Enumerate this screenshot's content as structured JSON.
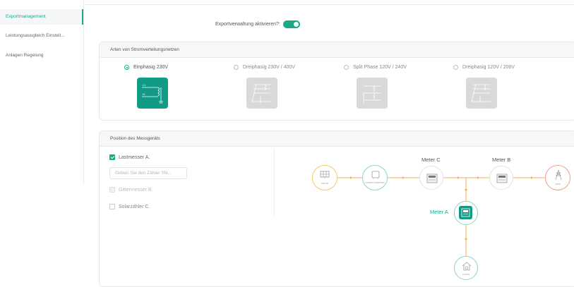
{
  "sidebar": {
    "items": [
      {
        "label": "Exportmanagement",
        "active": true
      },
      {
        "label": "Leistungsausgleich Einstell..."
      },
      {
        "label": "Anlagen Regelung"
      }
    ]
  },
  "export": {
    "label": "Exportverwaltung aktivieren?:",
    "enabled": true
  },
  "grid_types": {
    "title": "Arten von Stromverteilungsnetzen",
    "options": [
      {
        "label": "Einphasig 230V",
        "selected": true
      },
      {
        "label": "Dreiphasig 230V / 400V",
        "selected": false
      },
      {
        "label": "Split Phase 120V / 240V",
        "selected": false
      },
      {
        "label": "Dreiphasig 120V / 208V",
        "selected": false
      }
    ]
  },
  "meter_position": {
    "title": "Position des Messgeräts",
    "load_meter": {
      "label": "Lastmesser A.",
      "checked": true
    },
    "sn_input": {
      "placeholder": "Geben Sie den Zähler SN...",
      "value": ""
    },
    "grid_meter": {
      "label": "Gittermesser B.",
      "checked": false,
      "disabled": true
    },
    "solar_meter": {
      "label": "Solarzähler C.",
      "checked": false
    },
    "diagram": {
      "meter_c": "Meter C",
      "meter_b": "Meter B",
      "meter_a": "Meter A",
      "solar": "SOLAR",
      "inverter": "HYBRID INVERTER",
      "grid": "GRID",
      "loads": "LOADS"
    }
  },
  "colors": {
    "accent": "#1aaa8a",
    "solar_ring": "#f5c86a",
    "inverter_ring": "#8fd4c0",
    "grid_ring": "#f0a088",
    "flow_line": "#f3b14f"
  }
}
